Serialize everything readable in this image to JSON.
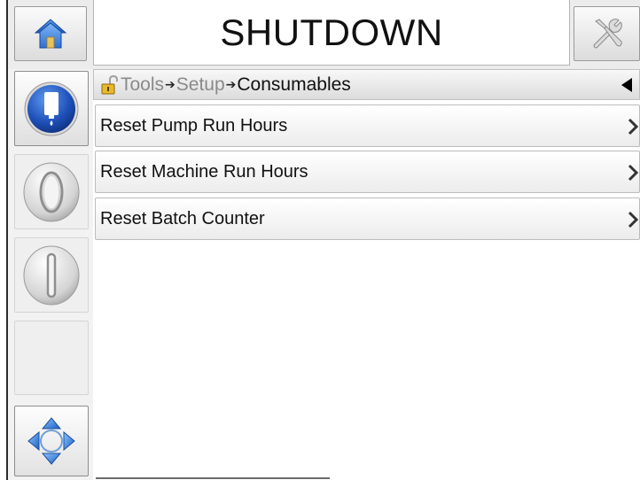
{
  "header": {
    "title": "SHUTDOWN",
    "home_icon": "home-icon",
    "tools_icon": "tools-icon"
  },
  "sidebar": {
    "items": [
      {
        "icon": "ink-cartridge-icon",
        "active": true
      },
      {
        "icon": "jet-stop-icon",
        "active": false
      },
      {
        "icon": "jet-start-icon",
        "active": false
      },
      {
        "icon": "",
        "active": false
      },
      {
        "icon": "navigation-arrows-icon",
        "active": false
      }
    ]
  },
  "breadcrumb": {
    "lock_icon": "padlock-icon",
    "crumb_1": "Tools",
    "arrow_1": "➔",
    "crumb_2": "Setup",
    "arrow_2": "➔",
    "current": "Consumables",
    "back_icon": "back-arrow-icon"
  },
  "menu": {
    "items": [
      {
        "label": "Reset Pump Run Hours"
      },
      {
        "label": "Reset Machine Run Hours"
      },
      {
        "label": "Reset Batch Counter"
      }
    ]
  },
  "colors": {
    "accent_blue": "#2a63c8",
    "header_bg": "#ececec",
    "crumb_dim": "#8a8a8a"
  }
}
